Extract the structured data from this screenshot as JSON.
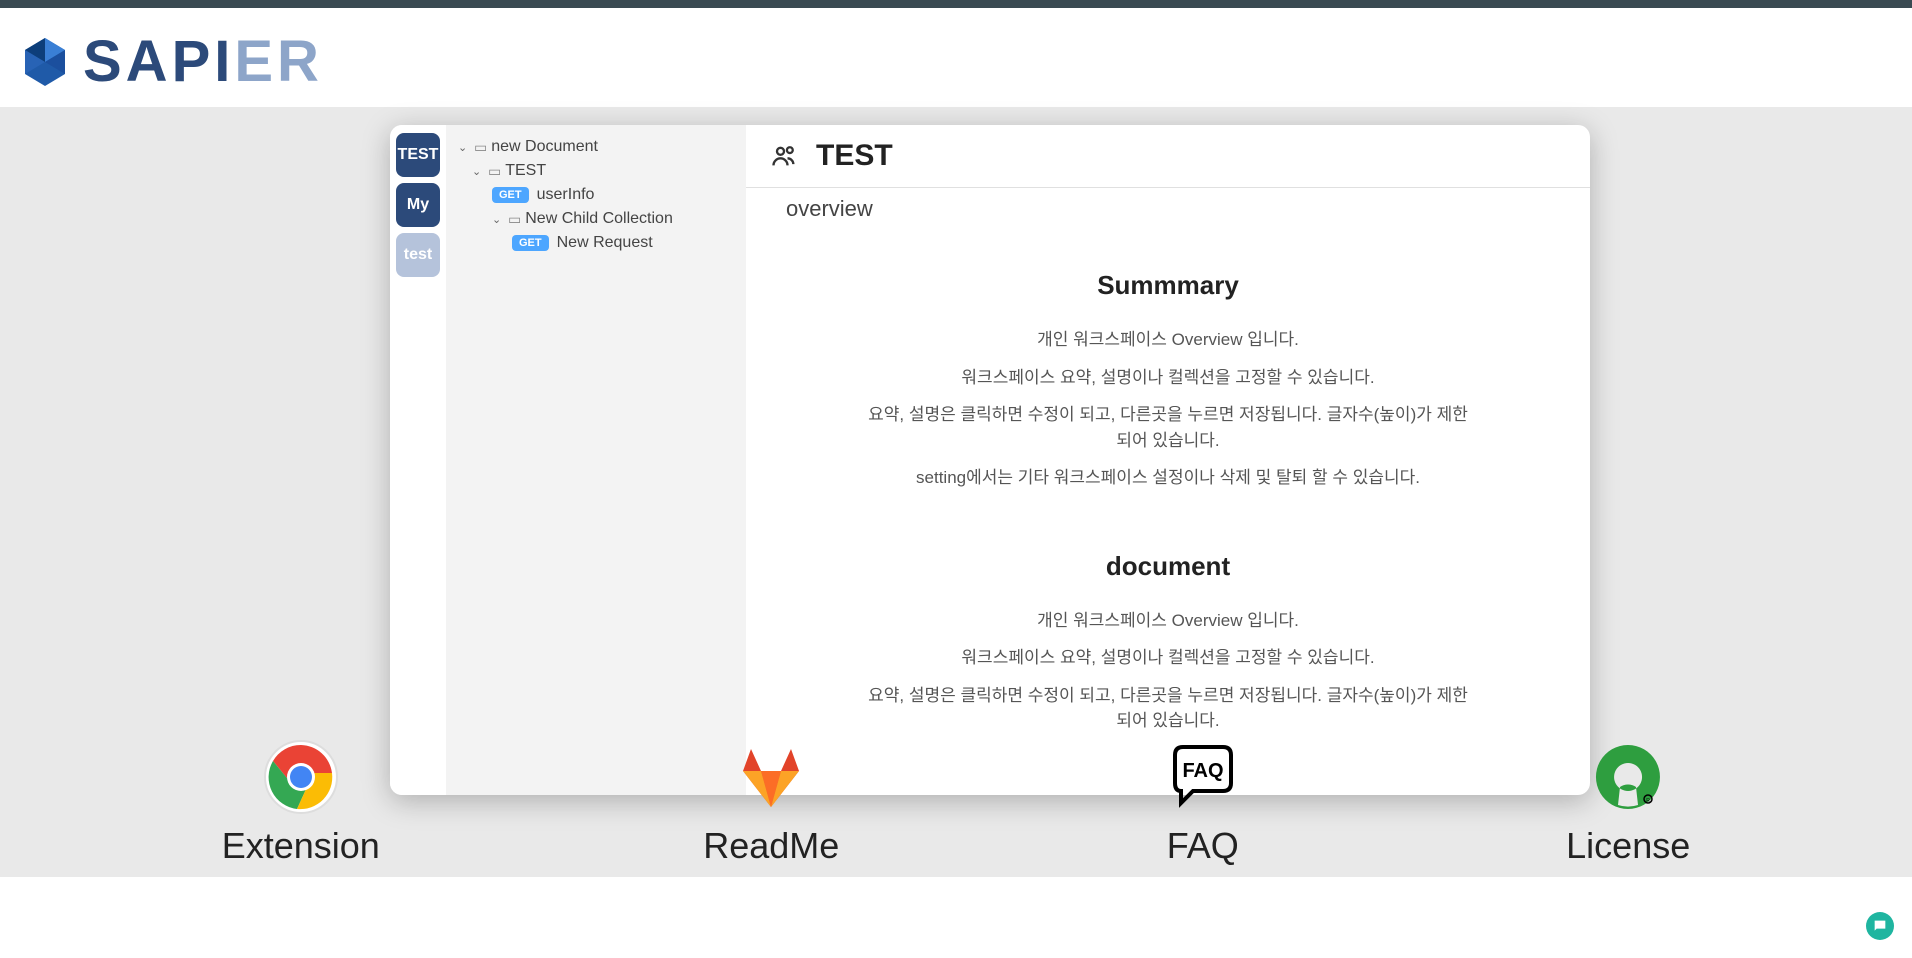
{
  "logo": {
    "text1": "SAPI",
    "text2": "ER"
  },
  "sidebarTabs": [
    {
      "label": "TEST",
      "class": "test1"
    },
    {
      "label": "My",
      "class": "my"
    },
    {
      "label": "test",
      "class": "test2"
    }
  ],
  "tree": {
    "doc1": "new Document",
    "doc2": "TEST",
    "item1": {
      "method": "GET",
      "name": "userInfo"
    },
    "coll": "New Child Collection",
    "item2": {
      "method": "GET",
      "name": "New Request"
    }
  },
  "content": {
    "title": "TEST",
    "subtitle": "overview",
    "summary": {
      "heading": "Summmary",
      "p1": "개인 워크스페이스 Overview 입니다.",
      "p2": "워크스페이스 요약, 설명이나 컬렉션을 고정할 수 있습니다.",
      "p3": "요약, 설명은 클릭하면 수정이 되고, 다른곳을 누르면 저장됩니다. 글자수(높이)가 제한되어 있습니다.",
      "p4": "setting에서는 기타 워크스페이스 설정이나 삭제 및 탈퇴 할 수 있습니다."
    },
    "document": {
      "heading": "document",
      "p1": "개인 워크스페이스 Overview 입니다.",
      "p2": "워크스페이스 요약, 설명이나 컬렉션을 고정할 수 있습니다.",
      "p3": "요약, 설명은 클릭하면 수정이 되고, 다른곳을 누르면 저장됩니다. 글자수(높이)가 제한되어 있습니다."
    }
  },
  "links": {
    "extension": "Extension",
    "readme": "ReadMe",
    "faq": "FAQ",
    "license": "License"
  }
}
